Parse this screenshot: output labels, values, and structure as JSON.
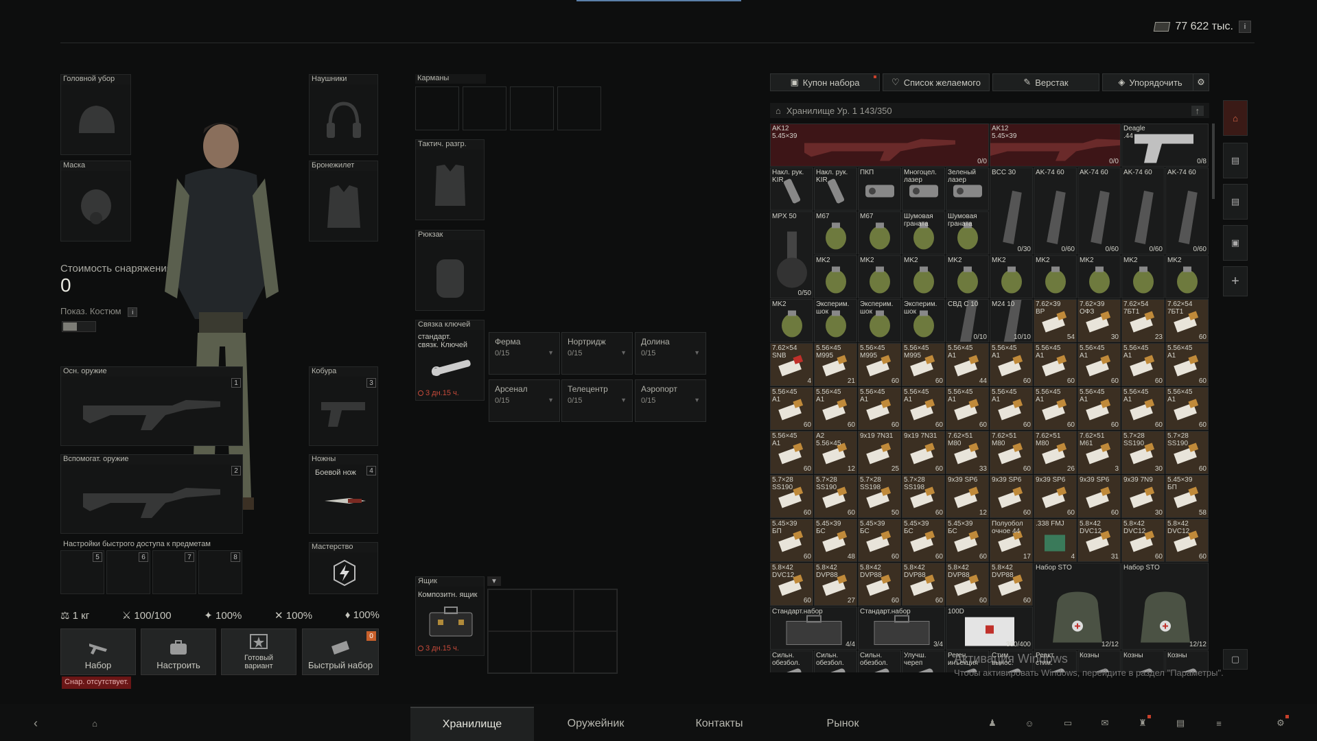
{
  "header": {
    "money": "77 622 тыс.",
    "info": "i"
  },
  "equipment": {
    "headwear": "Головной убор",
    "headset": "Наушники",
    "mask": "Маска",
    "armor": "Бронежилет",
    "pockets": "Карманы",
    "rig": "Тактич. разгр.",
    "backpack": "Рюкзак",
    "primary": "Осн. оружие",
    "primary_num": "1",
    "holster": "Кобура",
    "holster_num": "3",
    "secondary": "Вспомогат. оружие",
    "secondary_num": "2",
    "sheath": "Ножны",
    "sheath_num": "4",
    "knife_name": "Боевой нож",
    "mastery": "Мастерство",
    "gear_cost_label": "Стоимость снаряжения",
    "gear_cost_value": "0",
    "costume_label": "Показ. Костюм",
    "quick_access_title": "Настройки быстрого доступа к предметам",
    "quick_slots": [
      "5",
      "6",
      "7",
      "8"
    ]
  },
  "keychain": {
    "label": "Связка ключей",
    "item": "стандарт.\nсвязк. Ключей",
    "expire": "3 дн.15 ч.",
    "slots": [
      {
        "name": "Ферма",
        "count": "0/15"
      },
      {
        "name": "Нортридж",
        "count": "0/15"
      },
      {
        "name": "Долина",
        "count": "0/15"
      },
      {
        "name": "Арсенал",
        "count": "0/15"
      },
      {
        "name": "Телецентр",
        "count": "0/15"
      },
      {
        "name": "Аэропорт",
        "count": "0/15"
      }
    ]
  },
  "case": {
    "label": "Ящик",
    "item": "Композитн. ящик",
    "expire": "3 дн.15 ч."
  },
  "stats": {
    "weight": "1 кг",
    "durability": "100/100",
    "s1": "100%",
    "s2": "100%",
    "s3": "100%"
  },
  "bottom_buttons": {
    "kit": "Набор",
    "configure": "Настроить",
    "ready": "Готовый\nвариант",
    "quick_kit": "Быстрый набор",
    "quick_badge": "0",
    "no_kit": "Снар. отсутствует."
  },
  "stash_tabs": {
    "coupon": "Купон набора",
    "wishlist": "Список желаемого",
    "workbench": "Верстак",
    "sort": "Упорядочить"
  },
  "stash": {
    "title": "Хранилище Ур. 1 143/350",
    "items": [
      {
        "name": "AK12\n5.45×39",
        "count": "0/0",
        "c": 0,
        "r": 0,
        "w": 5,
        "h": 1,
        "kind": "gun-red"
      },
      {
        "name": "AK12\n5.45×39",
        "count": "0/0",
        "c": 5,
        "r": 0,
        "w": 3,
        "h": 1,
        "kind": "gun-red"
      },
      {
        "name": "Deagle\n.44",
        "count": "0/8",
        "c": 8,
        "r": 0,
        "w": 2,
        "h": 1,
        "kind": "pistol"
      },
      {
        "name": "Накл. рук.\nKIR",
        "count": "",
        "c": 0,
        "r": 1,
        "w": 1,
        "h": 1,
        "kind": "grip"
      },
      {
        "name": "Накл. рук.\nKIR",
        "count": "",
        "c": 1,
        "r": 1,
        "w": 1,
        "h": 1,
        "kind": "grip"
      },
      {
        "name": "ПКП",
        "count": "",
        "c": 2,
        "r": 1,
        "w": 1,
        "h": 1,
        "kind": "scope"
      },
      {
        "name": "Многоцел.\nлазер",
        "count": "",
        "c": 3,
        "r": 1,
        "w": 1,
        "h": 1,
        "kind": "scope"
      },
      {
        "name": "Зеленый\nлазер",
        "count": "",
        "c": 4,
        "r": 1,
        "w": 1,
        "h": 1,
        "kind": "scope"
      },
      {
        "name": "BCC 30",
        "count": "0/30",
        "c": 5,
        "r": 1,
        "w": 1,
        "h": 2,
        "kind": "mag"
      },
      {
        "name": "AK-74 60",
        "count": "0/60",
        "c": 6,
        "r": 1,
        "w": 1,
        "h": 2,
        "kind": "mag"
      },
      {
        "name": "AK-74 60",
        "count": "0/60",
        "c": 7,
        "r": 1,
        "w": 1,
        "h": 2,
        "kind": "mag"
      },
      {
        "name": "AK-74 60",
        "count": "0/60",
        "c": 8,
        "r": 1,
        "w": 1,
        "h": 2,
        "kind": "mag"
      },
      {
        "name": "AK-74 60",
        "count": "0/60",
        "c": 9,
        "r": 1,
        "w": 1,
        "h": 2,
        "kind": "mag"
      },
      {
        "name": "MPX 50",
        "count": "0/50",
        "c": 0,
        "r": 2,
        "w": 1,
        "h": 2,
        "kind": "drum"
      },
      {
        "name": "M67",
        "count": "",
        "c": 1,
        "r": 2,
        "w": 1,
        "h": 1,
        "kind": "nade"
      },
      {
        "name": "M67",
        "count": "",
        "c": 2,
        "r": 2,
        "w": 1,
        "h": 1,
        "kind": "nade"
      },
      {
        "name": "Шумовая\nграната",
        "count": "",
        "c": 3,
        "r": 2,
        "w": 1,
        "h": 1,
        "kind": "nade"
      },
      {
        "name": "Шумовая\nграната",
        "count": "",
        "c": 4,
        "r": 2,
        "w": 1,
        "h": 1,
        "kind": "nade"
      },
      {
        "name": "MK2",
        "count": "",
        "c": 1,
        "r": 3,
        "w": 1,
        "h": 1,
        "kind": "nade"
      },
      {
        "name": "MK2",
        "count": "",
        "c": 2,
        "r": 3,
        "w": 1,
        "h": 1,
        "kind": "nade"
      },
      {
        "name": "MK2",
        "count": "",
        "c": 3,
        "r": 3,
        "w": 1,
        "h": 1,
        "kind": "nade"
      },
      {
        "name": "MK2",
        "count": "",
        "c": 4,
        "r": 3,
        "w": 1,
        "h": 1,
        "kind": "nade"
      },
      {
        "name": "MK2",
        "count": "",
        "c": 5,
        "r": 3,
        "w": 1,
        "h": 1,
        "kind": "nade"
      },
      {
        "name": "MK2",
        "count": "",
        "c": 6,
        "r": 3,
        "w": 1,
        "h": 1,
        "kind": "nade"
      },
      {
        "name": "MK2",
        "count": "",
        "c": 7,
        "r": 3,
        "w": 1,
        "h": 1,
        "kind": "nade"
      },
      {
        "name": "MK2",
        "count": "",
        "c": 8,
        "r": 3,
        "w": 1,
        "h": 1,
        "kind": "nade"
      },
      {
        "name": "MK2",
        "count": "",
        "c": 9,
        "r": 3,
        "w": 1,
        "h": 1,
        "kind": "nade"
      },
      {
        "name": "MK2",
        "count": "",
        "c": 0,
        "r": 4,
        "w": 1,
        "h": 1,
        "kind": "nade"
      },
      {
        "name": "Эксперим.\nшок",
        "count": "",
        "c": 1,
        "r": 4,
        "w": 1,
        "h": 1,
        "kind": "nade"
      },
      {
        "name": "Эксперим.\nшок",
        "count": "",
        "c": 2,
        "r": 4,
        "w": 1,
        "h": 1,
        "kind": "nade"
      },
      {
        "name": "Эксперим.\nшок",
        "count": "",
        "c": 3,
        "r": 4,
        "w": 1,
        "h": 1,
        "kind": "nade"
      },
      {
        "name": "СВД С 10",
        "count": "0/10",
        "c": 4,
        "r": 4,
        "w": 1,
        "h": 1,
        "kind": "mag"
      },
      {
        "name": "M24 10",
        "count": "10/10",
        "c": 5,
        "r": 4,
        "w": 1,
        "h": 1,
        "kind": "mag"
      },
      {
        "name": "7.62×39\nBP",
        "count": "54",
        "c": 6,
        "r": 4,
        "w": 1,
        "h": 1,
        "kind": "ammo"
      },
      {
        "name": "7.62×39\nОФЗ",
        "count": "30",
        "c": 7,
        "r": 4,
        "w": 1,
        "h": 1,
        "kind": "ammo"
      },
      {
        "name": "7.62×54\n7БТ1",
        "count": "23",
        "c": 8,
        "r": 4,
        "w": 1,
        "h": 1,
        "kind": "ammo"
      },
      {
        "name": "7.62×54\n7БТ1",
        "count": "60",
        "c": 9,
        "r": 4,
        "w": 1,
        "h": 1,
        "kind": "ammo"
      },
      {
        "name": "7.62×54\nSNB",
        "count": "4",
        "c": 0,
        "r": 5,
        "w": 1,
        "h": 1,
        "kind": "ammo-red"
      },
      {
        "name": "5.56×45\nM995",
        "count": "21",
        "c": 1,
        "r": 5,
        "w": 1,
        "h": 1,
        "kind": "ammo"
      },
      {
        "name": "5.56×45\nM995",
        "count": "60",
        "c": 2,
        "r": 5,
        "w": 1,
        "h": 1,
        "kind": "ammo"
      },
      {
        "name": "5.56×45\nM995",
        "count": "60",
        "c": 3,
        "r": 5,
        "w": 1,
        "h": 1,
        "kind": "ammo"
      },
      {
        "name": "5.56×45\nA1",
        "count": "44",
        "c": 4,
        "r": 5,
        "w": 1,
        "h": 1,
        "kind": "ammo"
      },
      {
        "name": "5.56×45\nA1",
        "count": "60",
        "c": 5,
        "r": 5,
        "w": 1,
        "h": 1,
        "kind": "ammo"
      },
      {
        "name": "5.56×45\nA1",
        "count": "60",
        "c": 6,
        "r": 5,
        "w": 1,
        "h": 1,
        "kind": "ammo"
      },
      {
        "name": "5.56×45\nA1",
        "count": "60",
        "c": 7,
        "r": 5,
        "w": 1,
        "h": 1,
        "kind": "ammo"
      },
      {
        "name": "5.56×45\nA1",
        "count": "60",
        "c": 8,
        "r": 5,
        "w": 1,
        "h": 1,
        "kind": "ammo"
      },
      {
        "name": "5.56×45\nA1",
        "count": "60",
        "c": 9,
        "r": 5,
        "w": 1,
        "h": 1,
        "kind": "ammo"
      },
      {
        "name": "5.56×45\nA1",
        "count": "60",
        "c": 0,
        "r": 6,
        "w": 1,
        "h": 1,
        "kind": "ammo"
      },
      {
        "name": "5.56×45\nA1",
        "count": "60",
        "c": 1,
        "r": 6,
        "w": 1,
        "h": 1,
        "kind": "ammo"
      },
      {
        "name": "5.56×45\nA1",
        "count": "60",
        "c": 2,
        "r": 6,
        "w": 1,
        "h": 1,
        "kind": "ammo"
      },
      {
        "name": "5.56×45\nA1",
        "count": "60",
        "c": 3,
        "r": 6,
        "w": 1,
        "h": 1,
        "kind": "ammo"
      },
      {
        "name": "5.56×45\nA1",
        "count": "60",
        "c": 4,
        "r": 6,
        "w": 1,
        "h": 1,
        "kind": "ammo"
      },
      {
        "name": "5.56×45\nA1",
        "count": "60",
        "c": 5,
        "r": 6,
        "w": 1,
        "h": 1,
        "kind": "ammo"
      },
      {
        "name": "5.56×45\nA1",
        "count": "60",
        "c": 6,
        "r": 6,
        "w": 1,
        "h": 1,
        "kind": "ammo"
      },
      {
        "name": "5.56×45\nA1",
        "count": "60",
        "c": 7,
        "r": 6,
        "w": 1,
        "h": 1,
        "kind": "ammo"
      },
      {
        "name": "5.56×45\nA1",
        "count": "60",
        "c": 8,
        "r": 6,
        "w": 1,
        "h": 1,
        "kind": "ammo"
      },
      {
        "name": "5.56×45\nA1",
        "count": "60",
        "c": 9,
        "r": 6,
        "w": 1,
        "h": 1,
        "kind": "ammo"
      },
      {
        "name": "5.56×45\nA1",
        "count": "60",
        "c": 0,
        "r": 7,
        "w": 1,
        "h": 1,
        "kind": "ammo"
      },
      {
        "name": "A2\n5.56×45",
        "count": "12",
        "c": 1,
        "r": 7,
        "w": 1,
        "h": 1,
        "kind": "ammo"
      },
      {
        "name": "9x19 7N31",
        "count": "25",
        "c": 2,
        "r": 7,
        "w": 1,
        "h": 1,
        "kind": "ammo"
      },
      {
        "name": "9x19 7N31",
        "count": "60",
        "c": 3,
        "r": 7,
        "w": 1,
        "h": 1,
        "kind": "ammo"
      },
      {
        "name": "7.62×51\nM80",
        "count": "33",
        "c": 4,
        "r": 7,
        "w": 1,
        "h": 1,
        "kind": "ammo"
      },
      {
        "name": "7.62×51\nM80",
        "count": "60",
        "c": 5,
        "r": 7,
        "w": 1,
        "h": 1,
        "kind": "ammo"
      },
      {
        "name": "7.62×51\nM80",
        "count": "26",
        "c": 6,
        "r": 7,
        "w": 1,
        "h": 1,
        "kind": "ammo"
      },
      {
        "name": "7.62×51\nM61",
        "count": "3",
        "c": 7,
        "r": 7,
        "w": 1,
        "h": 1,
        "kind": "ammo"
      },
      {
        "name": "5.7×28\nSS190",
        "count": "30",
        "c": 8,
        "r": 7,
        "w": 1,
        "h": 1,
        "kind": "ammo"
      },
      {
        "name": "5.7×28\nSS190",
        "count": "60",
        "c": 9,
        "r": 7,
        "w": 1,
        "h": 1,
        "kind": "ammo"
      },
      {
        "name": "5.7×28\nSS190",
        "count": "60",
        "c": 0,
        "r": 8,
        "w": 1,
        "h": 1,
        "kind": "ammo"
      },
      {
        "name": "5.7×28\nSS190",
        "count": "60",
        "c": 1,
        "r": 8,
        "w": 1,
        "h": 1,
        "kind": "ammo"
      },
      {
        "name": "5.7×28\nSS198",
        "count": "50",
        "c": 2,
        "r": 8,
        "w": 1,
        "h": 1,
        "kind": "ammo"
      },
      {
        "name": "5.7×28\nSS198",
        "count": "60",
        "c": 3,
        "r": 8,
        "w": 1,
        "h": 1,
        "kind": "ammo"
      },
      {
        "name": "9x39 SP6",
        "count": "12",
        "c": 4,
        "r": 8,
        "w": 1,
        "h": 1,
        "kind": "ammo"
      },
      {
        "name": "9x39 SP6",
        "count": "60",
        "c": 5,
        "r": 8,
        "w": 1,
        "h": 1,
        "kind": "ammo"
      },
      {
        "name": "9x39 SP6",
        "count": "60",
        "c": 6,
        "r": 8,
        "w": 1,
        "h": 1,
        "kind": "ammo"
      },
      {
        "name": "9x39 SP6",
        "count": "60",
        "c": 7,
        "r": 8,
        "w": 1,
        "h": 1,
        "kind": "ammo"
      },
      {
        "name": "9x39 7N9",
        "count": "30",
        "c": 8,
        "r": 8,
        "w": 1,
        "h": 1,
        "kind": "ammo"
      },
      {
        "name": "5.45×39\nБП",
        "count": "58",
        "c": 9,
        "r": 8,
        "w": 1,
        "h": 1,
        "kind": "ammo"
      },
      {
        "name": "5.45×39\nБП",
        "count": "60",
        "c": 0,
        "r": 9,
        "w": 1,
        "h": 1,
        "kind": "ammo"
      },
      {
        "name": "5.45×39\nБС",
        "count": "48",
        "c": 1,
        "r": 9,
        "w": 1,
        "h": 1,
        "kind": "ammo"
      },
      {
        "name": "5.45×39\nБС",
        "count": "60",
        "c": 2,
        "r": 9,
        "w": 1,
        "h": 1,
        "kind": "ammo"
      },
      {
        "name": "5.45×39\nБС",
        "count": "60",
        "c": 3,
        "r": 9,
        "w": 1,
        "h": 1,
        "kind": "ammo"
      },
      {
        "name": "5.45×39\nБС",
        "count": "60",
        "c": 4,
        "r": 9,
        "w": 1,
        "h": 1,
        "kind": "ammo"
      },
      {
        "name": "Полуобол\nочное 44",
        "count": "17",
        "c": 5,
        "r": 9,
        "w": 1,
        "h": 1,
        "kind": "ammo"
      },
      {
        "name": ".338 FMJ",
        "count": "4",
        "c": 6,
        "r": 9,
        "w": 1,
        "h": 1,
        "kind": "ammo-green"
      },
      {
        "name": "5.8×42\nDVC12",
        "count": "31",
        "c": 7,
        "r": 9,
        "w": 1,
        "h": 1,
        "kind": "ammo"
      },
      {
        "name": "5.8×42\nDVC12",
        "count": "60",
        "c": 8,
        "r": 9,
        "w": 1,
        "h": 1,
        "kind": "ammo"
      },
      {
        "name": "5.8×42\nDVC12",
        "count": "60",
        "c": 9,
        "r": 9,
        "w": 1,
        "h": 1,
        "kind": "ammo"
      },
      {
        "name": "5.8×42\nDVC12",
        "count": "60",
        "c": 0,
        "r": 10,
        "w": 1,
        "h": 1,
        "kind": "ammo"
      },
      {
        "name": "5.8×42\nDVP88",
        "count": "27",
        "c": 1,
        "r": 10,
        "w": 1,
        "h": 1,
        "kind": "ammo"
      },
      {
        "name": "5.8×42\nDVP88",
        "count": "60",
        "c": 2,
        "r": 10,
        "w": 1,
        "h": 1,
        "kind": "ammo"
      },
      {
        "name": "5.8×42\nDVP88",
        "count": "60",
        "c": 3,
        "r": 10,
        "w": 1,
        "h": 1,
        "kind": "ammo"
      },
      {
        "name": "5.8×42\nDVP88",
        "count": "60",
        "c": 4,
        "r": 10,
        "w": 1,
        "h": 1,
        "kind": "ammo"
      },
      {
        "name": "5.8×42\nDVP88",
        "count": "60",
        "c": 5,
        "r": 10,
        "w": 1,
        "h": 1,
        "kind": "ammo"
      },
      {
        "name": "Набор STO",
        "count": "12/12",
        "c": 6,
        "r": 10,
        "w": 2,
        "h": 2,
        "kind": "bag"
      },
      {
        "name": "Набор STO",
        "count": "12/12",
        "c": 8,
        "r": 10,
        "w": 2,
        "h": 2,
        "kind": "bag"
      },
      {
        "name": "Стандарт.набор",
        "count": "4/4",
        "c": 0,
        "r": 11,
        "w": 2,
        "h": 1,
        "kind": "kitbox"
      },
      {
        "name": "Стандарт.набор",
        "count": "3/4",
        "c": 2,
        "r": 11,
        "w": 2,
        "h": 1,
        "kind": "kitbox"
      },
      {
        "name": "100D",
        "count": "360/400",
        "c": 4,
        "r": 11,
        "w": 2,
        "h": 1,
        "kind": "medbox"
      },
      {
        "name": "Сильн.\nобезбол.",
        "count": "",
        "c": 0,
        "r": 12,
        "w": 1,
        "h": 1,
        "kind": "pill"
      },
      {
        "name": "Сильн.\nобезбол.",
        "count": "",
        "c": 1,
        "r": 12,
        "w": 1,
        "h": 1,
        "kind": "pill"
      },
      {
        "name": "Сильн.\nобезбол.",
        "count": "",
        "c": 2,
        "r": 12,
        "w": 1,
        "h": 1,
        "kind": "pill"
      },
      {
        "name": "Улучш.\nчереп",
        "count": "",
        "c": 3,
        "r": 12,
        "w": 1,
        "h": 1,
        "kind": "pill"
      },
      {
        "name": "Реген.\nинъекция",
        "count": "",
        "c": 4,
        "r": 12,
        "w": 1,
        "h": 1,
        "kind": "pill"
      },
      {
        "name": "Стим.\nвынос.",
        "count": "",
        "c": 5,
        "r": 12,
        "w": 1,
        "h": 1,
        "kind": "pill"
      },
      {
        "name": "Реакт.\nстим.",
        "count": "",
        "c": 6,
        "r": 12,
        "w": 1,
        "h": 1,
        "kind": "pill"
      },
      {
        "name": "Козны",
        "count": "",
        "c": 7,
        "r": 12,
        "w": 1,
        "h": 1,
        "kind": "pill"
      },
      {
        "name": "Козны",
        "count": "",
        "c": 8,
        "r": 12,
        "w": 1,
        "h": 1,
        "kind": "pill"
      },
      {
        "name": "Козны",
        "count": "",
        "c": 9,
        "r": 12,
        "w": 1,
        "h": 1,
        "kind": "pill"
      }
    ]
  },
  "watermark": {
    "line1": "Активация Windows",
    "line2": "Чтобы активировать Windows, перейдите в раздел \"Параметры\"."
  },
  "bottom_tabs": {
    "stash": "Хранилище",
    "gunsmith": "Оружейник",
    "contacts": "Контакты",
    "market": "Рынок"
  },
  "colors": {
    "accent_red": "#c8402b",
    "ammo_bg": "#3b2f22",
    "weapon_red": "#3d1517"
  }
}
